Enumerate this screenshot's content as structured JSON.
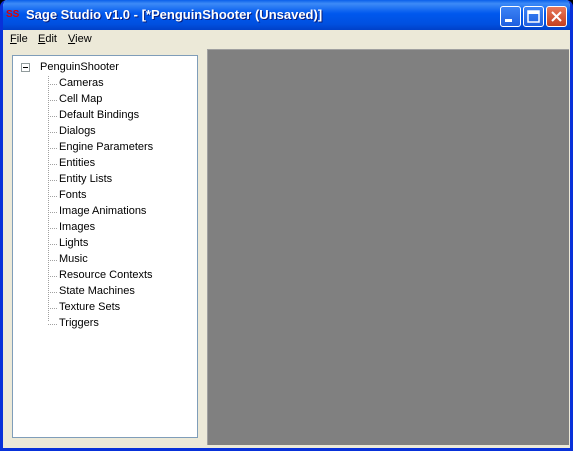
{
  "window": {
    "title": "Sage Studio v1.0 - [*PenguinShooter (Unsaved)]",
    "icon": "sage-studio-app-icon",
    "icon_text": "SS"
  },
  "menubar": {
    "items": [
      {
        "label": "File",
        "accel": "F",
        "rest": "ile"
      },
      {
        "label": "Edit",
        "accel": "E",
        "rest": "dit"
      },
      {
        "label": "View",
        "accel": "V",
        "rest": "iew"
      }
    ]
  },
  "tree": {
    "root": {
      "label": "PenguinShooter",
      "expanded": true
    },
    "children": [
      "Cameras",
      "Cell Map",
      "Default Bindings",
      "Dialogs",
      "Engine Parameters",
      "Entities",
      "Entity Lists",
      "Fonts",
      "Image Animations",
      "Images",
      "Lights",
      "Music",
      "Resource Contexts",
      "State Machines",
      "Texture Sets",
      "Triggers"
    ]
  },
  "colors": {
    "titlebar": "#0058EE",
    "canvas": "#808080",
    "chrome": "#ECE9D8"
  }
}
